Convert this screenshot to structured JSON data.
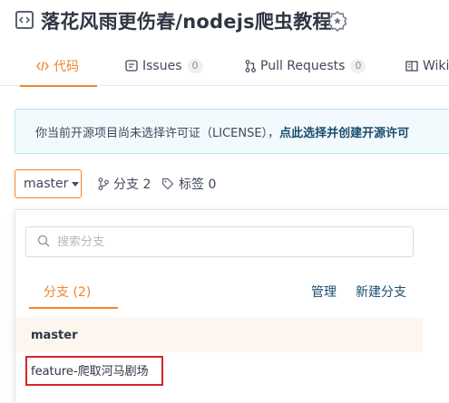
{
  "repo": {
    "title": "落花风雨更伤春/nodejs爬虫教程",
    "icon": "repo-icon",
    "badge_icon": "recommend-badge-icon"
  },
  "tabs": [
    {
      "label": "代码",
      "icon": "code-icon",
      "active": true
    },
    {
      "label": "Issues",
      "icon": "issues-icon",
      "count": "0"
    },
    {
      "label": "Pull Requests",
      "icon": "pull-request-icon",
      "count": "0"
    },
    {
      "label": "Wiki",
      "icon": "wiki-icon"
    }
  ],
  "notice": {
    "text": "你当前开源项目尚未选择许可证（LICENSE），",
    "link": "点此选择并创建开源许可"
  },
  "branch_bar": {
    "current_branch": "master",
    "branches": "分支 2",
    "tags": "标签 0"
  },
  "dropdown": {
    "search_placeholder": "搜索分支",
    "tab_branches": "分支 (2)",
    "manage": "管理",
    "new_branch": "新建分支",
    "items": [
      "master",
      "feature-爬取河马剧场"
    ]
  },
  "colors": {
    "accent": "#f0852b",
    "highlight_box": "#d8232a",
    "notice_bg": "#f2fafd"
  }
}
